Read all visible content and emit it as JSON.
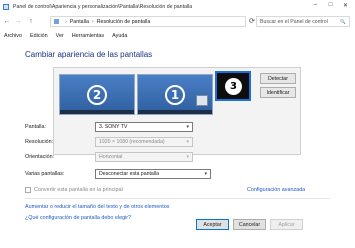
{
  "window": {
    "title": "Panel de control\\Apariencia y personalización\\Pantalla\\Resolución de pantalla",
    "minimize": "–",
    "maximize": "□",
    "close": "✕"
  },
  "address": {
    "back": "←",
    "forward": "→",
    "up": "↑",
    "breadcrumb": [
      "Pantalla",
      "Resolución de pantalla"
    ],
    "separator": "›",
    "refresh": "⟳",
    "search_placeholder": "Buscar en el Panel de control",
    "search_icon": "🔍"
  },
  "menu": [
    "Archivo",
    "Edición",
    "Ver",
    "Herramientas",
    "Ayuda"
  ],
  "heading": "Cambiar apariencia de las pantallas",
  "monitors": [
    {
      "number": "2"
    },
    {
      "number": "1"
    },
    {
      "number": "3"
    }
  ],
  "buttons": {
    "detect": "Detectar",
    "identify": "Identificar"
  },
  "form": {
    "display_label": "Pantalla:",
    "display_value": "3. SONY TV",
    "resolution_label": "Resolución:",
    "resolution_value": "1920 × 1080 (recomendada)",
    "orientation_label": "Orientación:",
    "orientation_value": "Horizontal",
    "multiple_label": "Varias pantallas:",
    "multiple_value": "Desconectar esta pantalla",
    "dropdown_caret": "▾"
  },
  "checkbox_label": "Convertir esta pantalla en la principal",
  "advanced_link": "Configuración avanzada",
  "links": [
    "Aumentar o reducir el tamaño del texto y de otros elementos",
    "¿Qué configuración de pantalla debo elegir?"
  ],
  "footer": {
    "accept": "Aceptar",
    "cancel": "Cancelar",
    "apply": "Aplicar"
  },
  "colors": {
    "accent": "#1e6fd9",
    "heading": "#1e3287",
    "link": "#1b5cc7"
  }
}
